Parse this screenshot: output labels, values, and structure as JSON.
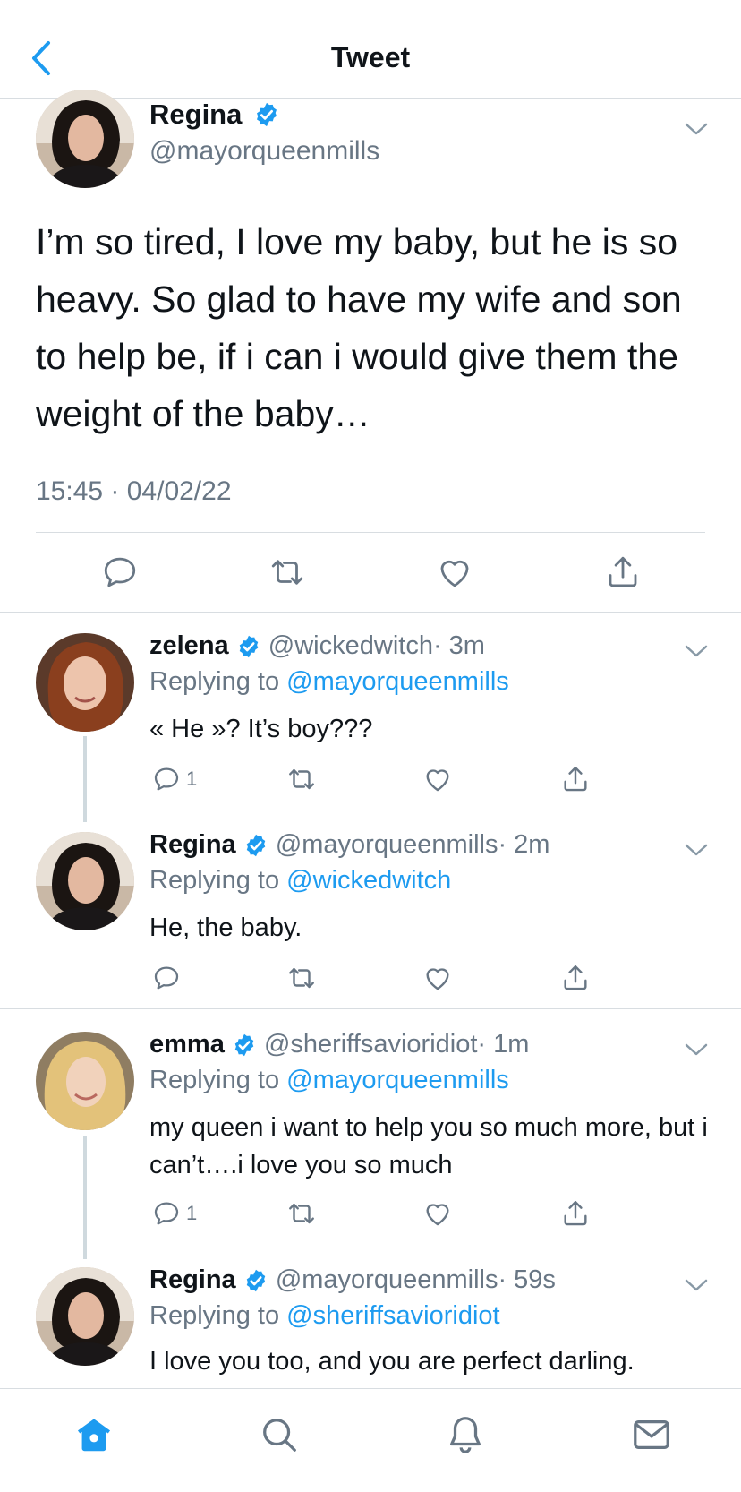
{
  "header": {
    "title": "Tweet",
    "back_icon": "chevron-left-icon"
  },
  "colors": {
    "accent": "#1d9bf0",
    "secondary_text": "#687684",
    "divider": "#d8dde1"
  },
  "main_tweet": {
    "name": "Regina",
    "handle": "@mayorqueenmills",
    "text": "I’m so tired, I love my baby, but he is so heavy. So glad to have my wife and son to help be, if i can i would give them the weight of the baby…",
    "timestamp": "15:45 · 04/02/22"
  },
  "replies": [
    {
      "name": "zelena",
      "handle": "@wickedwitch",
      "time": "· 3m",
      "replying_label": "Replying to",
      "replying_to": "@mayorqueenmills",
      "text": "« He »? It’s boy???",
      "reply_count": "1"
    },
    {
      "name": "Regina",
      "handle": "@mayorqueenmills",
      "time": "· 2m",
      "replying_label": "Replying to",
      "replying_to": "@wickedwitch",
      "text": "He, the baby.",
      "reply_count": ""
    },
    {
      "name": "emma",
      "handle": "@sheriffsavioridiot",
      "time": "· 1m",
      "replying_label": "Replying to",
      "replying_to": "@mayorqueenmills",
      "text": "my queen i want to help you so much more, but i can’t….i love you so much",
      "reply_count": "1"
    },
    {
      "name": "Regina",
      "handle": "@mayorqueenmills",
      "time": "· 59s",
      "replying_label": "Replying to",
      "replying_to": "@sheriffsavioridiot",
      "text": "I love you too, and you are perfect darling.",
      "reply_count": ""
    }
  ],
  "tabbar": {
    "items": [
      "home-icon",
      "search-icon",
      "bell-icon",
      "mail-icon"
    ]
  }
}
